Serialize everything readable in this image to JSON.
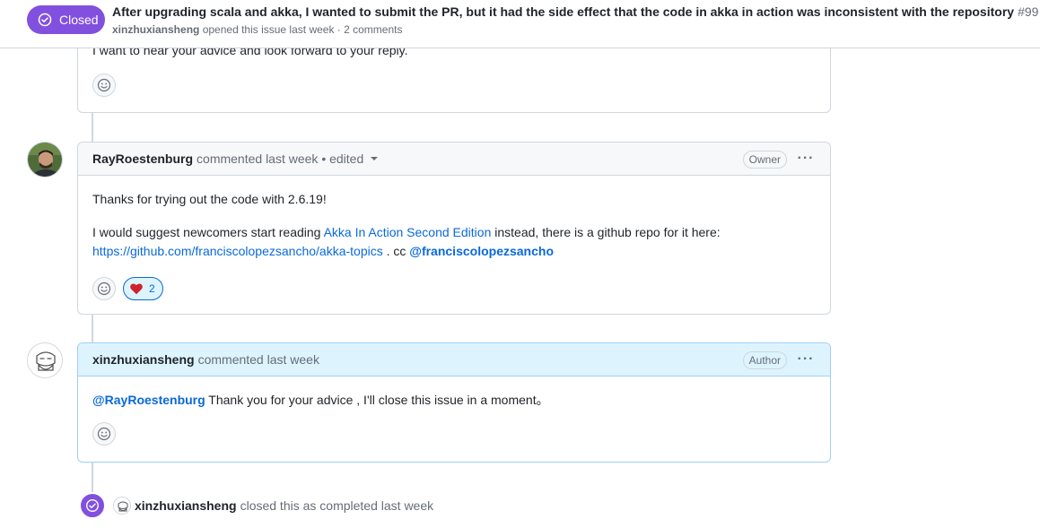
{
  "header": {
    "state_label": "Closed",
    "title": "After upgrading scala and akka, I wanted to submit the PR, but it had the side effect that the code in akka in action was inconsistent with the repository",
    "number": "#99",
    "opener": "xinzhuxiansheng",
    "meta_text": "opened this issue last week · 2 comments"
  },
  "comments": [
    {
      "body_partial": "I want to hear your advice and look forward to your reply."
    },
    {
      "author": "RayRoestenburg",
      "meta": "commented last week • edited",
      "role": "Owner",
      "line1": "Thanks for trying out the code with 2.6.19!",
      "line2_pre": "I would suggest newcomers start reading ",
      "line2_link": "Akka In Action Second Edition",
      "line2_post": " instead, there is a github repo for it here:",
      "line3_link": "https://github.com/franciscolopezsancho/akka-topics",
      "line3_mid": " . cc ",
      "line3_mention": "@franciscolopezsancho",
      "reaction_count": "2"
    },
    {
      "author": "xinzhuxiansheng",
      "meta": "commented last week",
      "role": "Author",
      "mention": "@RayRoestenburg",
      "body": " Thank you for your advice , I'll close this issue in a moment。"
    }
  ],
  "event": {
    "actor": "xinzhuxiansheng",
    "text": "closed this as completed last week"
  },
  "colors": {
    "closed_purple": "#8250df",
    "link_blue": "#0969da",
    "author_header_bg": "#ddf4ff",
    "border": "#d0d7de"
  },
  "icons": [
    "check-circle-icon",
    "smiley-icon",
    "heart-icon",
    "kebab-horizontal-icon",
    "triangle-down-icon"
  ]
}
